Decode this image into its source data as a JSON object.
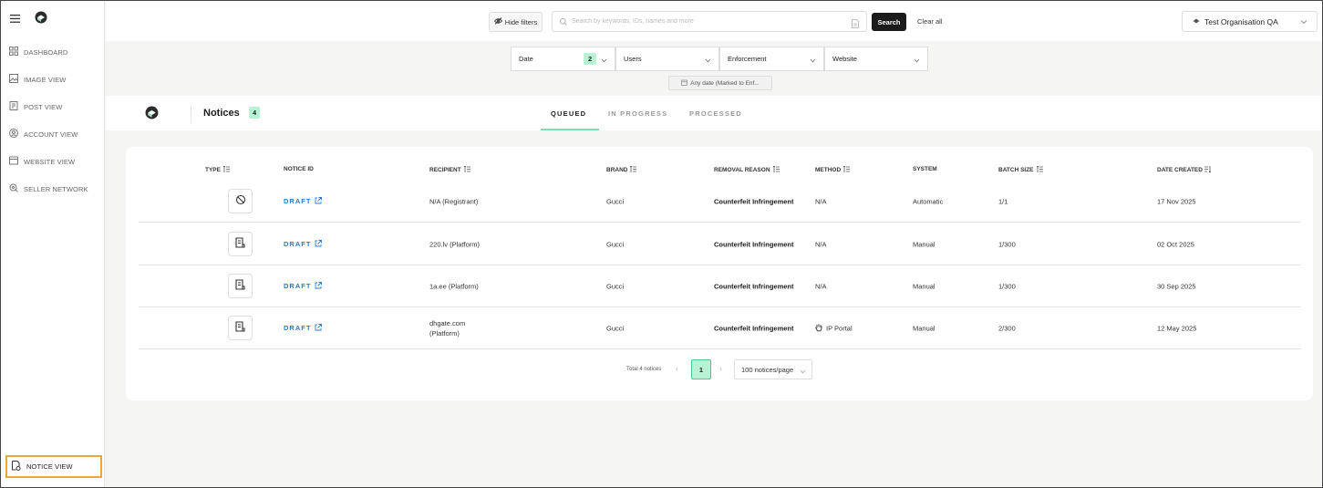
{
  "sidebar": {
    "menu_icon": "hamburger-icon",
    "logo_icon": "app-logo-icon",
    "items": [
      {
        "label": "DASHBOARD",
        "icon": "dashboard-icon"
      },
      {
        "label": "IMAGE VIEW",
        "icon": "image-icon"
      },
      {
        "label": "POST VIEW",
        "icon": "post-icon"
      },
      {
        "label": "ACCOUNT VIEW",
        "icon": "account-icon"
      },
      {
        "label": "WEBSITE VIEW",
        "icon": "website-icon"
      },
      {
        "label": "SELLER NETWORK",
        "icon": "network-icon"
      }
    ],
    "active_item": {
      "label": "NOTICE VIEW",
      "icon": "notice-icon"
    }
  },
  "topbar": {
    "hide_filters_label": "Hide filters",
    "search_placeholder": "Search by keywords, IDs, names and more",
    "search_button_label": "Search",
    "clear_all_label": "Clear all",
    "organisation": "Test Organisation QA"
  },
  "filters": {
    "items": [
      {
        "label": "Date",
        "count": "2"
      },
      {
        "label": "Users"
      },
      {
        "label": "Enforcement"
      },
      {
        "label": "Website"
      }
    ],
    "active_chip": "Any date (Marked to Enf..."
  },
  "notices": {
    "title": "Notices",
    "count": "4",
    "tabs": [
      "QUEUED",
      "IN PROGRESS",
      "PROCESSED"
    ],
    "active_tab": "QUEUED"
  },
  "table": {
    "headers": {
      "type": "TYPE",
      "notice_id": "NOTICE ID",
      "recipient": "RECIPIENT",
      "brand": "BRAND",
      "removal_reason": "REMOVAL REASON",
      "method": "METHOD",
      "system": "SYSTEM",
      "batch_size": "BATCH SIZE",
      "date_created": "DATE CREATED"
    },
    "rows": [
      {
        "type_icon": "domain-notice-icon",
        "notice_id": "DRAFT",
        "recipient_line1": "N/A (Registrant)",
        "recipient_line2": "",
        "brand": "Gucci",
        "removal_reason": "Counterfeit Infringement",
        "method": "N/A",
        "system": "Automatic",
        "batch_size": "1/1",
        "date_created": "17 Nov 2025"
      },
      {
        "type_icon": "document-notice-icon",
        "notice_id": "DRAFT",
        "recipient_line1": "220.lv (Platform)",
        "recipient_line2": "",
        "brand": "Gucci",
        "removal_reason": "Counterfeit Infringement",
        "method": "N/A",
        "system": "Manual",
        "batch_size": "1/300",
        "date_created": "02 Oct 2025"
      },
      {
        "type_icon": "document-notice-icon",
        "notice_id": "DRAFT",
        "recipient_line1": "1a.ee (Platform)",
        "recipient_line2": "",
        "brand": "Gucci",
        "removal_reason": "Counterfeit Infringement",
        "method": "N/A",
        "system": "Manual",
        "batch_size": "1/300",
        "date_created": "30 Sep 2025"
      },
      {
        "type_icon": "document-notice-icon",
        "notice_id": "DRAFT",
        "recipient_line1": "dhgate.com",
        "recipient_line2": "(Platform)",
        "brand": "Gucci",
        "removal_reason": "Counterfeit Infringement",
        "method": "IP Portal",
        "method_icon": "hand-icon",
        "system": "Manual",
        "batch_size": "2/300",
        "date_created": "12 May 2025"
      }
    ]
  },
  "pagination": {
    "total": "Total 4 notices",
    "current_page": "1",
    "page_size": "100 notices/page"
  }
}
